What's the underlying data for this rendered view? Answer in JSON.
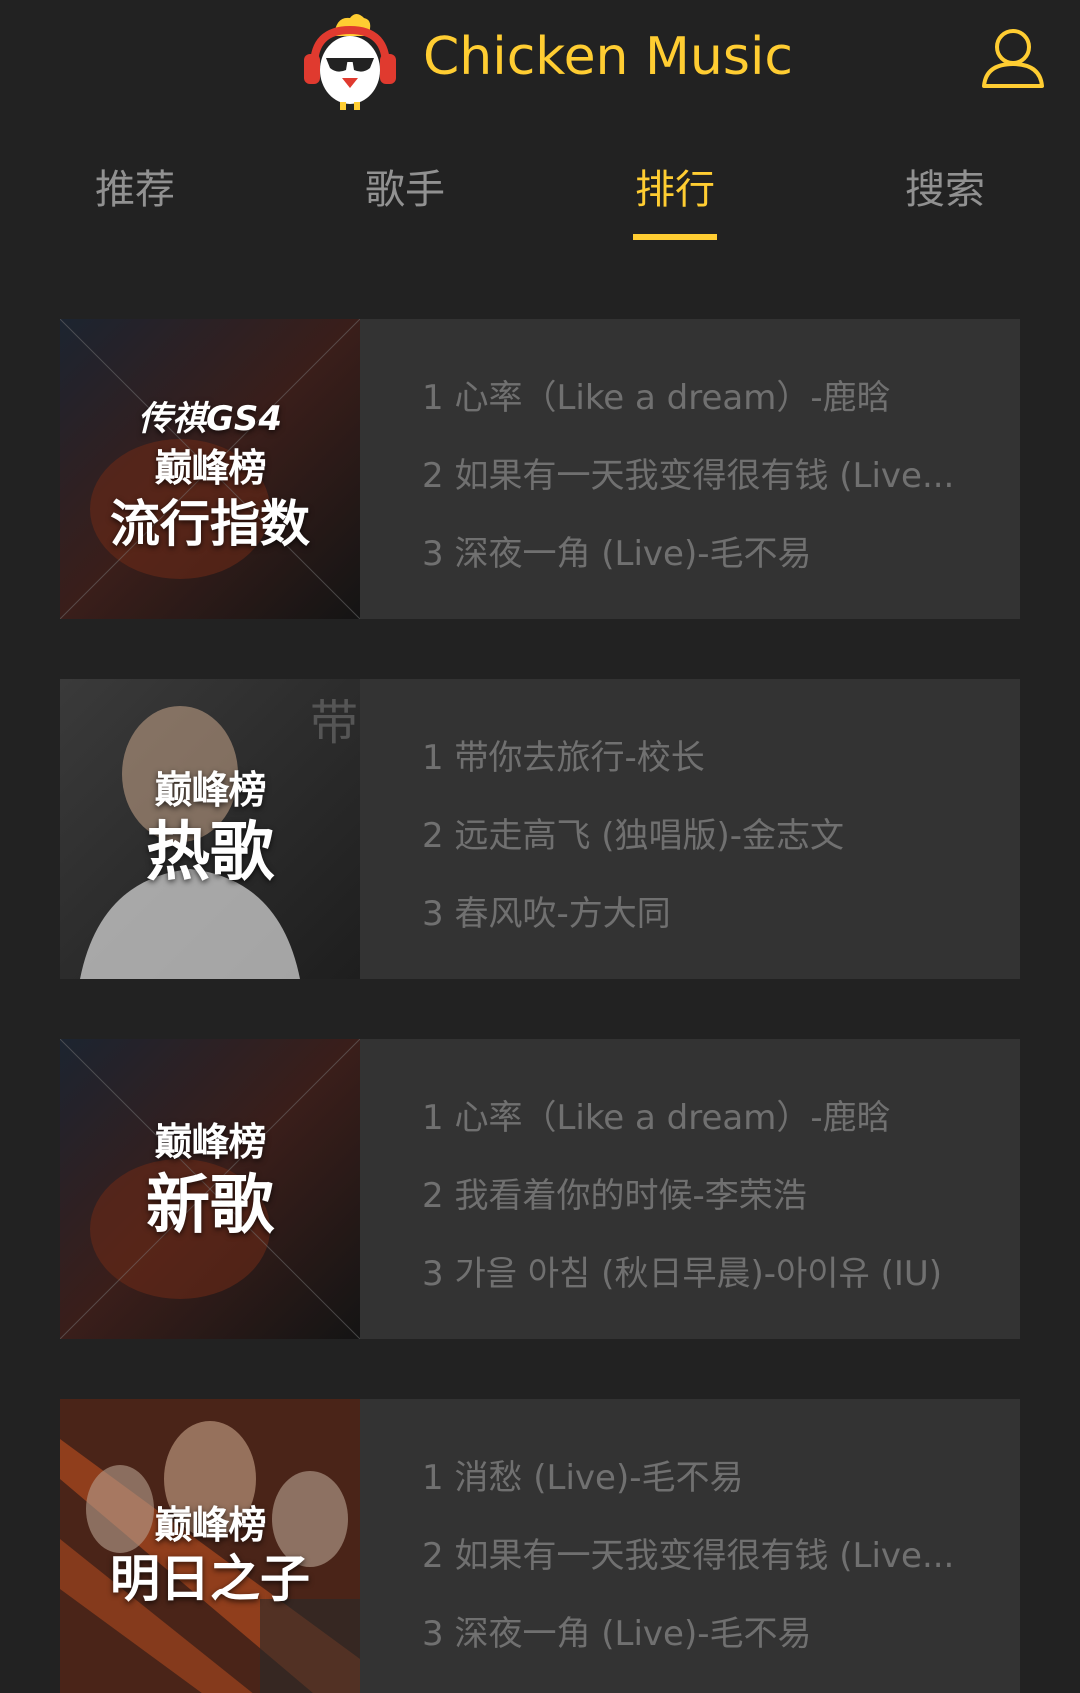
{
  "app": {
    "title": "Chicken Music",
    "accent_color": "#ffcd32",
    "background_color": "#222222",
    "logo_icon": "chicken-headphones-logo",
    "user_icon": "user-icon"
  },
  "tabs": [
    {
      "label": "推荐",
      "active": false
    },
    {
      "label": "歌手",
      "active": false
    },
    {
      "label": "排行",
      "active": true
    },
    {
      "label": "搜索",
      "active": false
    }
  ],
  "ranks": [
    {
      "cover_brand": "巅峰榜",
      "cover_sub": "传祺GS4",
      "cover_title": "流行指数",
      "songs": [
        "1 心率（Like a dream）-鹿晗",
        "2 如果有一天我变得很有钱 (Live...",
        "3 深夜一角 (Live)-毛不易"
      ]
    },
    {
      "cover_brand": "巅峰榜",
      "cover_title": "热歌",
      "songs": [
        "1 带你去旅行-校长",
        "2 远走高飞 (独唱版)-金志文",
        "3 春风吹-方大同"
      ]
    },
    {
      "cover_brand": "巅峰榜",
      "cover_title": "新歌",
      "songs": [
        "1 心率（Like a dream）-鹿晗",
        "2 我看着你的时候-李荣浩",
        "3 가을 아침 (秋日早晨)-아이유 (IU)"
      ]
    },
    {
      "cover_brand": "巅峰榜",
      "cover_title": "明日之子",
      "songs": [
        "1 消愁 (Live)-毛不易",
        "2 如果有一天我变得很有钱 (Live...",
        "3 深夜一角 (Live)-毛不易"
      ]
    }
  ]
}
